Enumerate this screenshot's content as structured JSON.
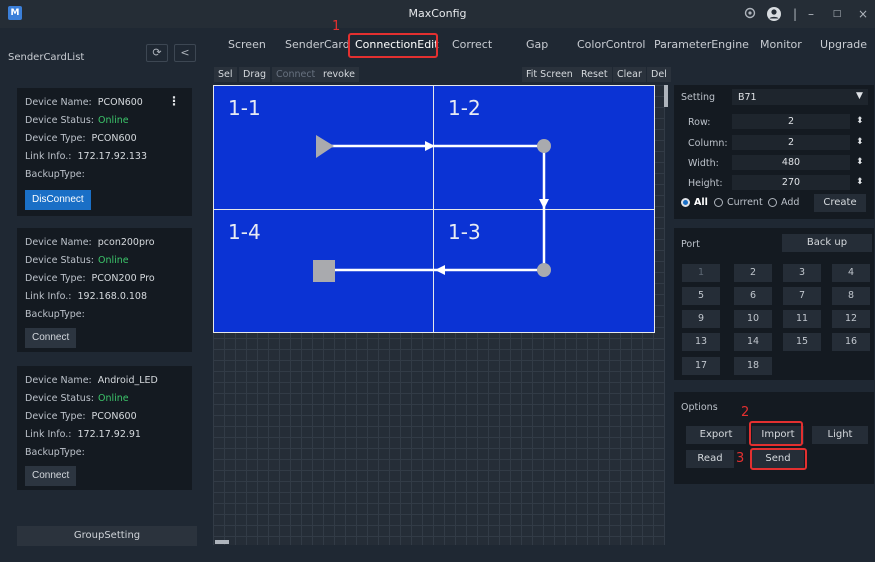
{
  "window": {
    "app_icon": "M",
    "title": "MaxConfig",
    "settings_icon": "gear-icon",
    "user_icon": "user-icon",
    "separator": "|",
    "minimize": "–",
    "maximize": "□",
    "close": "×"
  },
  "sidebar": {
    "title": "SenderCardList",
    "refresh_icon": "⟳",
    "collapse_icon": "<",
    "labels": {
      "name": "Device Name:",
      "status": "Device Status:",
      "type": "Device Type:",
      "link": "Link Info.:",
      "backup": "BackupType:"
    },
    "cards": [
      {
        "name": "PCON600",
        "status": "Online",
        "type": "PCON600",
        "link": "172.17.92.133",
        "button": "DisConnect",
        "menu": "⋮"
      },
      {
        "name": "pcon200pro",
        "status": "Online",
        "type": "PCON200 Pro",
        "link": "192.168.0.108",
        "button": "Connect"
      },
      {
        "name": "Android_LED",
        "status": "Online",
        "type": "PCON600",
        "link": "172.17.92.91",
        "button": "Connect"
      }
    ],
    "group_setting": "GroupSetting"
  },
  "tabs": [
    "Screen",
    "SenderCard",
    "ConnectionEdit",
    "Correct",
    "Gap",
    "ColorControl",
    "ParameterEngine",
    "Monitor",
    "Upgrade"
  ],
  "toolbar": {
    "left": [
      "Sel",
      "Drag",
      "Connect",
      "revoke"
    ],
    "right": [
      "Fit Screen",
      "Reset",
      "Clear",
      "Del"
    ]
  },
  "canvas": {
    "cells": [
      "1-1",
      "1-2",
      "1-3",
      "1-4"
    ]
  },
  "settings": {
    "label": "Setting",
    "value": "B71",
    "dropdown_icon": "▼",
    "spin_icon": "⬍",
    "row_label": "Row:",
    "row": "2",
    "column_label": "Column:",
    "column": "2",
    "width_label": "Width:",
    "width": "480",
    "height_label": "Height:",
    "height": "270",
    "radio_all": "All",
    "radio_current": "Current",
    "radio_add": "Add",
    "create": "Create"
  },
  "port": {
    "label": "Port",
    "backup": "Back up",
    "numbers": [
      "1",
      "2",
      "3",
      "4",
      "5",
      "6",
      "7",
      "8",
      "9",
      "10",
      "11",
      "12",
      "13",
      "14",
      "15",
      "16",
      "17",
      "18"
    ]
  },
  "options": {
    "label": "Options",
    "export": "Export",
    "import": "Import",
    "light": "Light",
    "read": "Read",
    "send": "Send"
  },
  "annotations": [
    "1",
    "2",
    "3"
  ],
  "colors": {
    "accent": "#1a6fc6",
    "online": "#3cc46a",
    "highlight": "#e33030",
    "screen": "#0b33d4"
  }
}
